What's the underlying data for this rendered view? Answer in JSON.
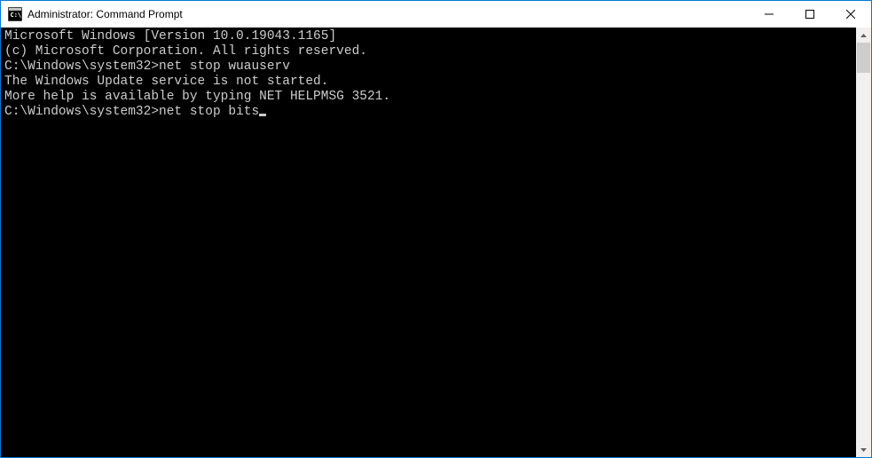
{
  "window": {
    "title": "Administrator: Command Prompt"
  },
  "console": {
    "lines": [
      "Microsoft Windows [Version 10.0.19043.1165]",
      "(c) Microsoft Corporation. All rights reserved.",
      ""
    ],
    "prompt1": "C:\\Windows\\system32>",
    "command1": "net stop wuauserv",
    "response1": "The Windows Update service is not started.",
    "blank1": "",
    "response2": "More help is available by typing NET HELPMSG 3521.",
    "blank2": "",
    "blank3": "",
    "prompt2": "C:\\Windows\\system32>",
    "command2": "net stop bits"
  }
}
